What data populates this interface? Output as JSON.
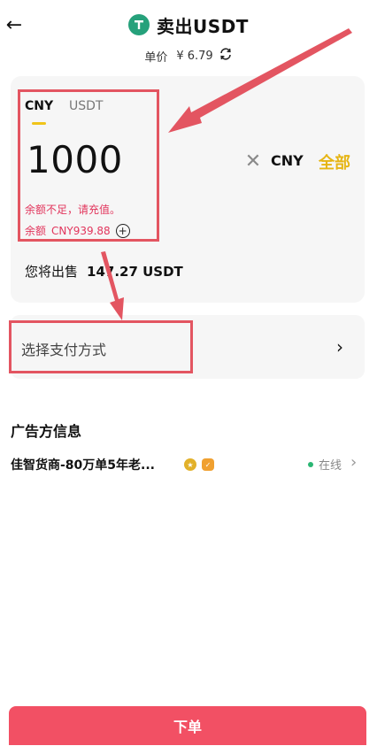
{
  "header": {
    "title": "卖出USDT",
    "price_label": "单价",
    "price_value": "¥ 6.79"
  },
  "tabs": [
    {
      "label": "CNY"
    },
    {
      "label": "USDT"
    }
  ],
  "amount": {
    "value": "1000",
    "unit": "CNY",
    "all_label": "全部",
    "error": "余额不足，请充值。",
    "balance_label": "余额",
    "balance_value": "CNY939.88"
  },
  "sell": {
    "label": "您将出售",
    "value": "147.27 USDT"
  },
  "payment": {
    "label": "选择支付方式"
  },
  "advertiser": {
    "section_title": "广告方信息",
    "name": "佳智货商-80万单5年老...",
    "status": "在线"
  },
  "order_button": "下单",
  "colors": {
    "accent": "#f25064",
    "error": "#e2355c",
    "highlight": "#e6b514",
    "annotation": "#e35561"
  },
  "icons": [
    "back-arrow-icon",
    "tether-icon",
    "refresh-icon",
    "clear-icon",
    "add-circle-icon",
    "chevron-right-icon",
    "verified-badge-icon",
    "shield-badge-icon"
  ]
}
